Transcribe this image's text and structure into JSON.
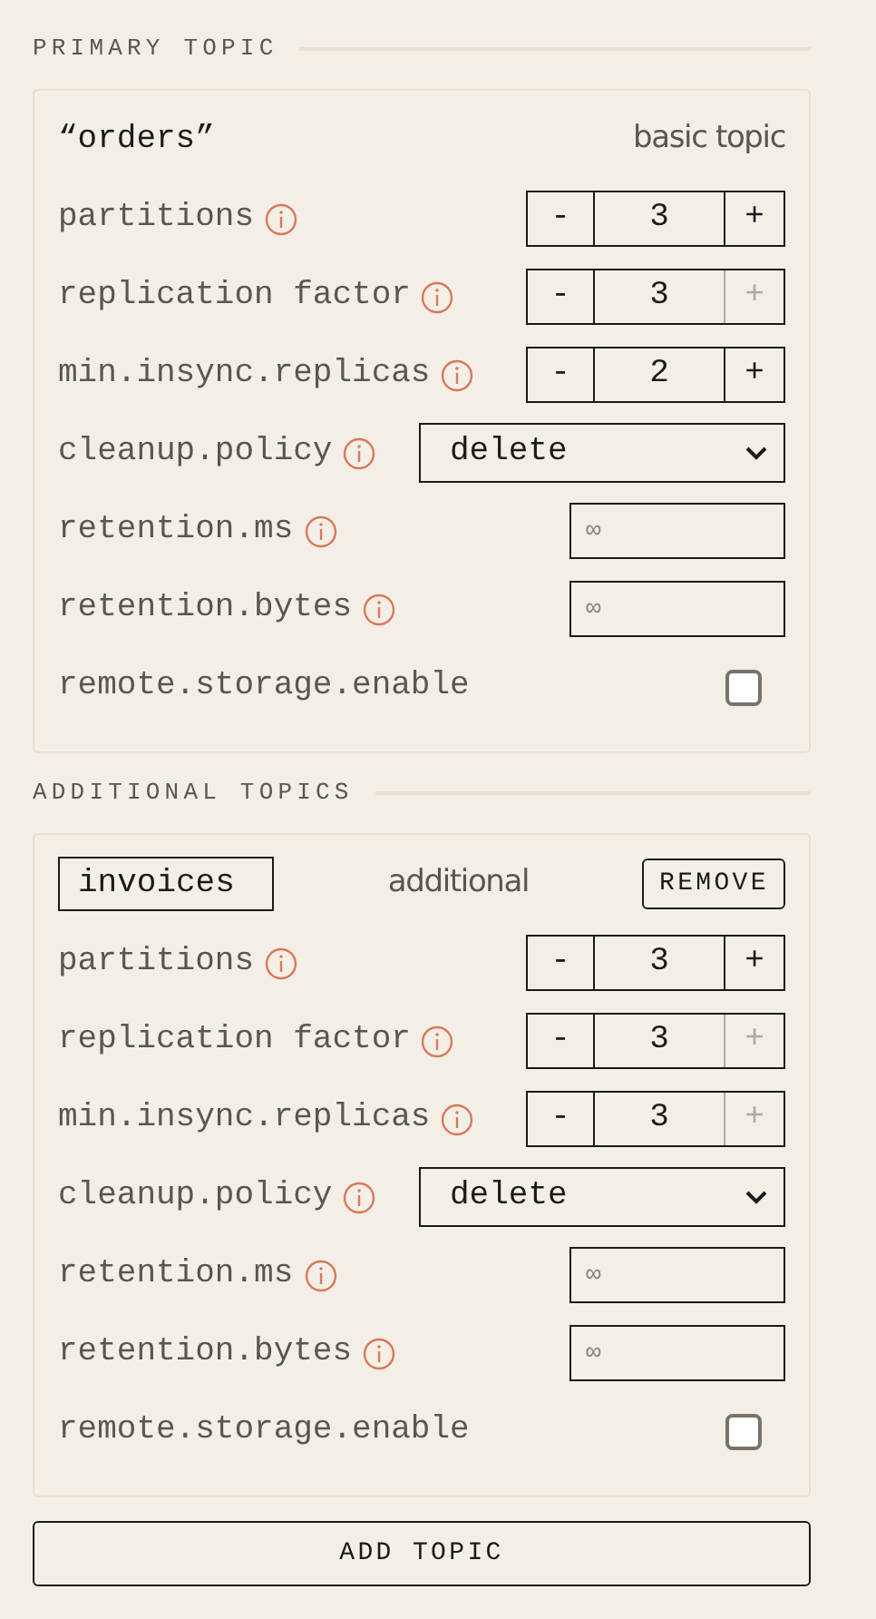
{
  "sections": [
    {
      "title": "PRIMARY TOPIC",
      "topics": [
        {
          "kind": "primary",
          "name": "“orders”",
          "tag": "basic topic",
          "settings": [
            {
              "kind": "stepper",
              "label": "partitions",
              "info": true,
              "minus": "-",
              "value": "3",
              "plus": "+",
              "plus_disabled": false
            },
            {
              "kind": "stepper",
              "label": "replication factor",
              "info": true,
              "minus": "-",
              "value": "3",
              "plus": "+",
              "plus_disabled": true
            },
            {
              "kind": "stepper",
              "label": "min.insync.replicas",
              "info": true,
              "minus": "-",
              "value": "2",
              "plus": "+",
              "plus_disabled": false
            },
            {
              "kind": "select",
              "label": "cleanup.policy",
              "info": true,
              "value": "delete"
            },
            {
              "kind": "input",
              "label": "retention.ms",
              "info": true,
              "placeholder": "∞"
            },
            {
              "kind": "input",
              "label": "retention.bytes",
              "info": true,
              "placeholder": "∞"
            },
            {
              "kind": "checkbox",
              "label": "remote.storage.enable",
              "info": false,
              "checked": false
            }
          ]
        }
      ]
    },
    {
      "title": "ADDITIONAL TOPICS",
      "topics": [
        {
          "kind": "additional",
          "name": "invoices",
          "tag": "additional",
          "remove": "REMOVE",
          "settings": [
            {
              "kind": "stepper",
              "label": "partitions",
              "info": true,
              "minus": "-",
              "value": "3",
              "plus": "+",
              "plus_disabled": false
            },
            {
              "kind": "stepper",
              "label": "replication factor",
              "info": true,
              "minus": "-",
              "value": "3",
              "plus": "+",
              "plus_disabled": true
            },
            {
              "kind": "stepper",
              "label": "min.insync.replicas",
              "info": true,
              "minus": "-",
              "value": "3",
              "plus": "+",
              "plus_disabled": true
            },
            {
              "kind": "select",
              "label": "cleanup.policy",
              "info": true,
              "value": "delete"
            },
            {
              "kind": "input",
              "label": "retention.ms",
              "info": true,
              "placeholder": "∞"
            },
            {
              "kind": "input",
              "label": "retention.bytes",
              "info": true,
              "placeholder": "∞"
            },
            {
              "kind": "checkbox",
              "label": "remote.storage.enable",
              "info": false,
              "checked": false
            }
          ]
        }
      ]
    }
  ],
  "add_button": "ADD TOPIC"
}
